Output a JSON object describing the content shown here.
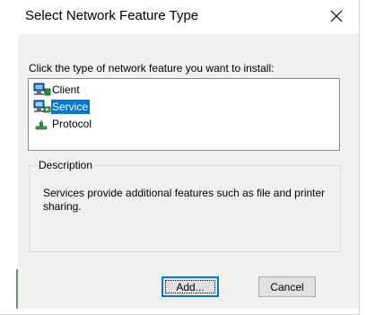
{
  "dialog": {
    "title": "Select Network Feature Type",
    "close_glyph": "✕",
    "instruction": "Click the type of network feature you want to install:"
  },
  "list": {
    "items": [
      {
        "label": "Client",
        "icon": "client-network-icon",
        "selected": false
      },
      {
        "label": "Service",
        "icon": "service-network-icon",
        "selected": true
      },
      {
        "label": "Protocol",
        "icon": "protocol-network-icon",
        "selected": false
      }
    ]
  },
  "description": {
    "legend": "Description",
    "text": "Services provide additional features such as file and printer sharing."
  },
  "buttons": {
    "add_label": "Add...",
    "cancel_label": "Cancel"
  },
  "colors": {
    "selection": "#0078d7",
    "dialog_background": "#f0f0f0",
    "button_face": "#e1e1e1"
  }
}
